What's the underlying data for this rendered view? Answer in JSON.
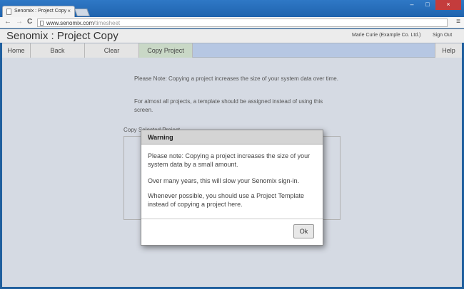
{
  "browser": {
    "tab_title": "Senomix : Project Copy",
    "tab_close_glyph": "×",
    "url_host": "www.senomix.com",
    "url_path": "/timesheet",
    "window_controls": {
      "minimize": "–",
      "maximize": "□",
      "close": "×"
    },
    "nav_glyphs": {
      "back": "←",
      "forward": "→",
      "reload": "C",
      "menu": "≡"
    }
  },
  "app": {
    "title": "Senomix : Project Copy",
    "user_label": "Marie Curie  (Example Co. Ltd.)",
    "sign_out": "Sign Out"
  },
  "nav": {
    "home": "Home",
    "back": "Back",
    "clear": "Clear",
    "copy_project": "Copy Project",
    "help": "Help"
  },
  "page": {
    "note1": "Please Note: Copying a project increases the size of your system data over time.",
    "note2": "For almost all projects, a template should be assigned instead of using this screen.",
    "underbox_label": "Copy Selected Project"
  },
  "modal": {
    "title": "Warning",
    "p1": "Please note: Copying a project increases the size of your system data by a small amount.",
    "p2": "Over many years, this will slow your Senomix sign-in.",
    "p3": "Whenever possible, you should use a Project Template instead of copying a project here.",
    "ok": "Ok"
  },
  "colors": {
    "navbar_fill": "#b6c7e3",
    "active_tab": "#c9d8c6",
    "content_bg": "#d5dae3",
    "titlebar": "#2f78c6"
  }
}
